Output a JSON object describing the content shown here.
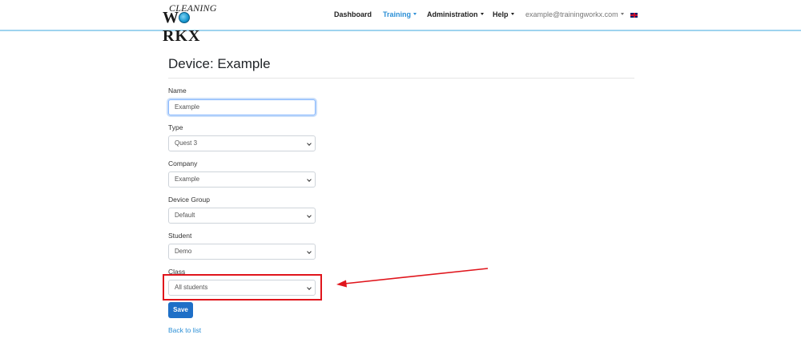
{
  "header": {
    "logo": {
      "line1": "CLEANING",
      "line2": "W",
      "line2_rest": "RKX"
    },
    "nav": [
      {
        "label": "Dashboard",
        "dropdown": false,
        "active": false
      },
      {
        "label": "Training",
        "dropdown": true,
        "active": true
      },
      {
        "label": "Administration",
        "dropdown": true,
        "active": false
      },
      {
        "label": "Help",
        "dropdown": true,
        "active": false
      }
    ],
    "user": "example@trainingworkx.com",
    "language_icon": "uk-flag-icon"
  },
  "page": {
    "title": "Device: Example"
  },
  "form": {
    "name": {
      "label": "Name",
      "value": "Example"
    },
    "type": {
      "label": "Type",
      "value": "Quest 3"
    },
    "company": {
      "label": "Company",
      "value": "Example"
    },
    "device_group": {
      "label": "Device Group",
      "value": "Default"
    },
    "student": {
      "label": "Student",
      "value": "Demo"
    },
    "class": {
      "label": "Class",
      "value": "All students"
    },
    "save_label": "Save",
    "back_label": "Back to list"
  },
  "colors": {
    "accent": "#2b8fd6",
    "button": "#1e6fc7",
    "annotation": "#e0151c",
    "header_border": "#9ed3ef"
  }
}
